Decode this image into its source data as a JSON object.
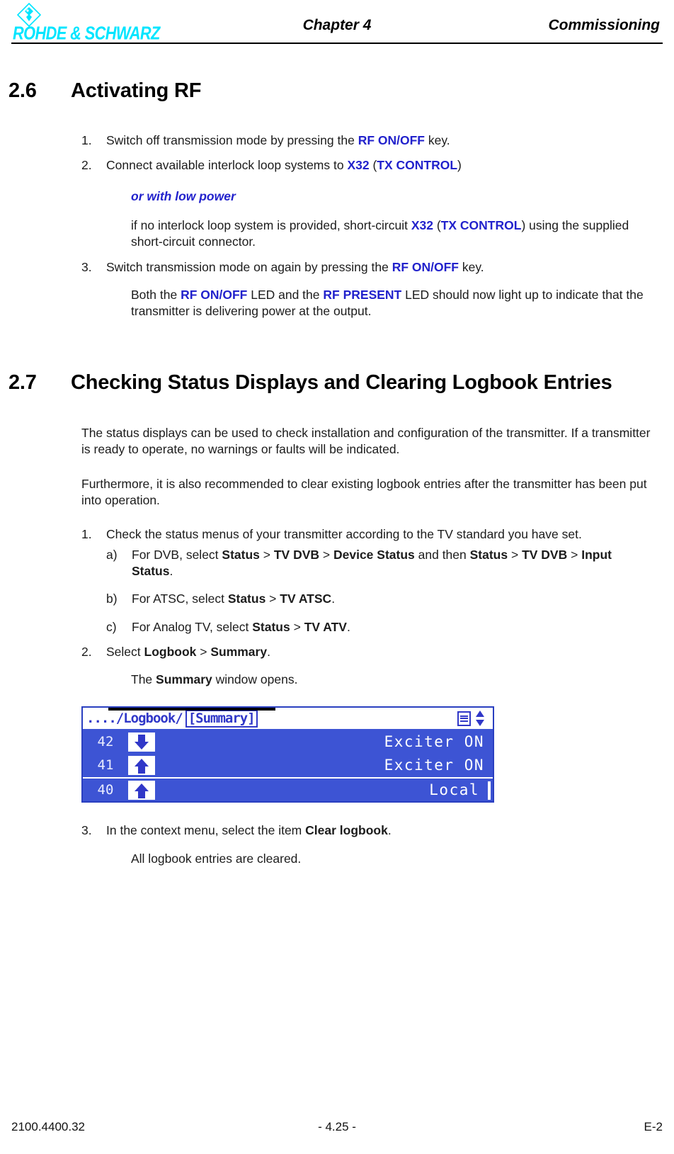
{
  "header": {
    "logo_icon": "rohde-schwarz-diamond-icon",
    "logo_text": "ROHDE & SCHWARZ",
    "logo_color": "#00e5ff",
    "chapter": "Chapter 4",
    "right_title": "Commissioning"
  },
  "sections": [
    {
      "number": "2.6",
      "title": "Activating RF"
    },
    {
      "number": "2.7",
      "title": "Checking Status Displays and Clearing Logbook Entries"
    }
  ],
  "sec26": {
    "step1": {
      "marker": "1.",
      "t1": "Switch off transmission mode by pressing the ",
      "b1": "RF ON/OFF",
      "t2": " key."
    },
    "step2": {
      "marker": "2.",
      "t1": "Connect available interlock loop systems to ",
      "b1": "X32",
      "t2": " (",
      "b2": "TX CONTROL",
      "t3": ")"
    },
    "low_power_note": "or with low power",
    "low_power_body": {
      "t1": "if no interlock loop system is provided, short-circuit ",
      "b1": "X32",
      "t2": " (",
      "b2": "TX CONTROL",
      "t3": ") using the supplied short-circuit connector."
    },
    "step3": {
      "marker": "3.",
      "t1": "Switch transmission mode on again by pressing the ",
      "b1": "RF ON/OFF",
      "t2": " key."
    },
    "step3_note": {
      "t1": "Both the ",
      "b1": "RF ON/OFF",
      "t2": " LED and the ",
      "b2": "RF PRESENT",
      "t3": " LED should now light up to indicate that the transmitter is delivering power at the output."
    }
  },
  "sec27": {
    "intro1": "The status displays can be used to check installation and configuration of the transmitter. If a transmitter is ready to operate, no warnings or faults will be indicated.",
    "intro2": "Furthermore, it is also recommended to clear existing logbook entries after the transmitter has been put into operation.",
    "step1": {
      "marker": "1.",
      "text": "Check the status menus of your transmitter according to the TV standard you have set."
    },
    "sub_a": {
      "marker": "a)",
      "t1": "For DVB, select ",
      "b1": "Status",
      "t2": " > ",
      "b2": "TV DVB",
      "t3": " > ",
      "b3": "Device Status",
      "t4": " and then ",
      "b4": "Status",
      "t5": " > ",
      "b5": "TV DVB",
      "t6": " > ",
      "b6": "Input Status",
      "t7": "."
    },
    "sub_b": {
      "marker": "b)",
      "t1": "For ATSC, select ",
      "b1": "Status",
      "t2": " > ",
      "b2": "TV ATSC",
      "t3": "."
    },
    "sub_c": {
      "marker": "c)",
      "t1": "For Analog TV, select ",
      "b1": "Status",
      "t2": " > ",
      "b2": "TV ATV",
      "t3": "."
    },
    "step2": {
      "marker": "2.",
      "t1": "Select ",
      "b1": "Logbook",
      "t2": " > ",
      "b2": "Summary",
      "t3": "."
    },
    "step2_note": {
      "t1": "The ",
      "b1": "Summary",
      "t2": " window opens."
    },
    "step3": {
      "marker": "3.",
      "t1": "In the context menu, select the item ",
      "b1": "Clear logbook",
      "t2": "."
    },
    "step3_note": "All logbook entries are cleared."
  },
  "lcd": {
    "breadcrumb": "..../Logbook/",
    "tab": "[Summary]",
    "icons": [
      "list-icon",
      "up-down-arrows-icon"
    ],
    "rows": [
      {
        "index": "42",
        "arrow": "down",
        "text": "Exciter ON"
      },
      {
        "index": "41",
        "arrow": "up",
        "text": "Exciter ON"
      },
      {
        "index": "40",
        "arrow": "up",
        "text": "Local"
      }
    ],
    "bg_color": "#3d54d4",
    "fg_color": "#ffffff"
  },
  "footer": {
    "left": "2100.4400.32",
    "center": "- 4.25 -",
    "right": "E-2"
  }
}
